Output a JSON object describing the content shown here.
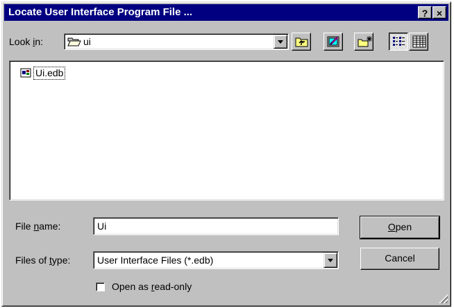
{
  "window": {
    "title": "Locate User Interface Program File ...",
    "help_glyph": "?",
    "close_glyph": "×"
  },
  "lookin": {
    "label_pre": "Look ",
    "label_key": "i",
    "label_post": "n:",
    "value": "ui"
  },
  "toolbar": {
    "up_icon": "up-one-level-icon",
    "desktop_icon": "desktop-icon",
    "newfolder_icon": "new-folder-icon",
    "list_icon": "list-view-icon",
    "details_icon": "details-view-icon"
  },
  "files": [
    {
      "name": "Ui.edb",
      "icon": "edb-file-icon"
    }
  ],
  "filename": {
    "label_pre": "File ",
    "label_key": "n",
    "label_post": "ame:",
    "value": "Ui"
  },
  "filetype": {
    "label_pre": "Files of ",
    "label_key": "t",
    "label_post": "ype:",
    "value": "User Interface Files (*.edb)"
  },
  "buttons": {
    "open_key": "O",
    "open_rest": "pen",
    "cancel": "Cancel"
  },
  "readonly": {
    "label_pre": "Open as ",
    "label_key": "r",
    "label_post": "ead-only",
    "checked": false
  },
  "colors": {
    "titlebar": "#000080",
    "face": "#c0c0c0"
  }
}
